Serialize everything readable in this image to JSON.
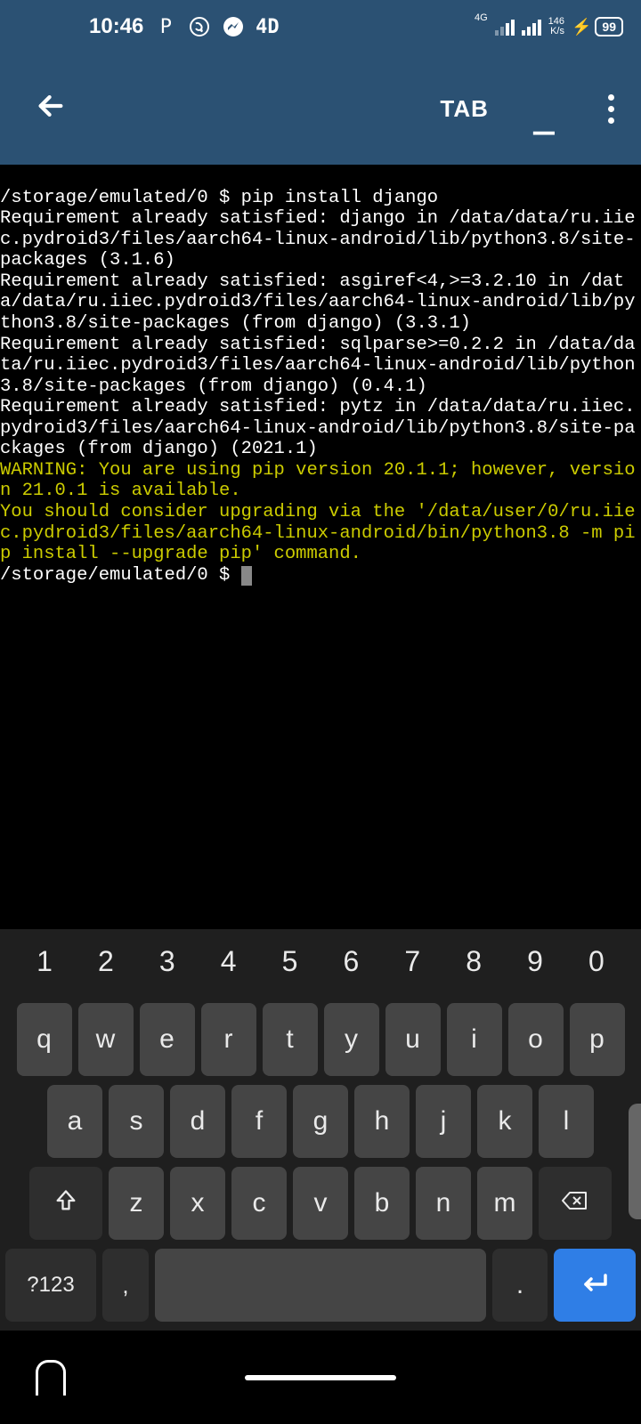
{
  "status": {
    "time": "10:46",
    "net_label": "4G",
    "kbs_top": "146",
    "kbs_bottom": "K/s",
    "battery": "99"
  },
  "appbar": {
    "tab_label": "TAB"
  },
  "terminal": {
    "prompt1": "/storage/emulated/0 $ pip install django",
    "line1": "Requirement already satisfied: django in /data/data/ru.iiec.pydroid3/files/aarch64-linux-android/lib/python3.8/site-packages (3.1.6)",
    "line2": "Requirement already satisfied: asgiref<4,>=3.2.10 in /data/data/ru.iiec.pydroid3/files/aarch64-linux-android/lib/python3.8/site-packages (from django) (3.3.1)",
    "line3": "Requirement already satisfied: sqlparse>=0.2.2 in /data/data/ru.iiec.pydroid3/files/aarch64-linux-android/lib/python3.8/site-packages (from django) (0.4.1)",
    "line4": "Requirement already satisfied: pytz in /data/data/ru.iiec.pydroid3/files/aarch64-linux-android/lib/python3.8/site-packages (from django) (2021.1)",
    "warn1": "WARNING: You are using pip version 20.1.1; however, version 21.0.1 is available.",
    "warn2": "You should consider upgrading via the '/data/user/0/ru.iiec.pydroid3/files/aarch64-linux-android/bin/python3.8 -m pip install --upgrade pip' command.",
    "prompt2": "/storage/emulated/0 $ "
  },
  "keyboard": {
    "numbers": [
      "1",
      "2",
      "3",
      "4",
      "5",
      "6",
      "7",
      "8",
      "9",
      "0"
    ],
    "row1": [
      "q",
      "w",
      "e",
      "r",
      "t",
      "y",
      "u",
      "i",
      "o",
      "p"
    ],
    "row2": [
      "a",
      "s",
      "d",
      "f",
      "g",
      "h",
      "j",
      "k",
      "l"
    ],
    "row3": [
      "z",
      "x",
      "c",
      "v",
      "b",
      "n",
      "m"
    ],
    "symbols": "?123",
    "comma": ",",
    "period": "."
  }
}
